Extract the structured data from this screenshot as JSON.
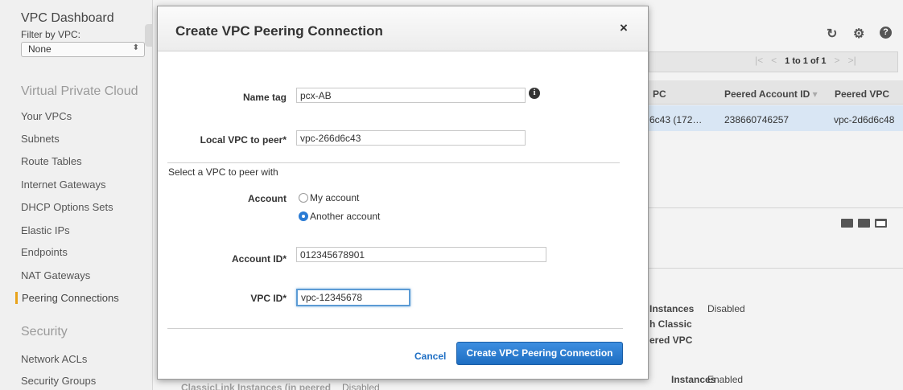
{
  "sidebar": {
    "title": "VPC Dashboard",
    "filter_label": "Filter by VPC:",
    "filter_value": "None",
    "sections": [
      {
        "label": "Virtual Private Cloud"
      },
      {
        "label": "Security"
      }
    ],
    "items": [
      {
        "label": "Your VPCs"
      },
      {
        "label": "Subnets"
      },
      {
        "label": "Route Tables"
      },
      {
        "label": "Internet Gateways"
      },
      {
        "label": "DHCP Options Sets"
      },
      {
        "label": "Elastic IPs"
      },
      {
        "label": "Endpoints"
      },
      {
        "label": "NAT Gateways"
      },
      {
        "label": "Peering Connections",
        "active": true
      },
      {
        "label": "Network ACLs"
      },
      {
        "label": "Security Groups"
      }
    ]
  },
  "toolbar": {
    "icons": [
      "refresh-icon",
      "gear-icon",
      "help-icon"
    ]
  },
  "pager": {
    "text": "1 to 1 of 1"
  },
  "table": {
    "columns": [
      "PC",
      "Peered Account ID",
      "Peered VPC"
    ],
    "rows": [
      [
        "6c43 (172…",
        "238660746257",
        "vpc-2d6d6c48"
      ]
    ]
  },
  "details": {
    "labels": [
      "Instances",
      "h Classic",
      "ered VPC",
      "Instances",
      "ClassicLink Instances (in peered"
    ],
    "values": [
      "Disabled",
      "Enabled",
      "Disabled"
    ]
  },
  "modal": {
    "title": "Create VPC Peering Connection",
    "close_label": "×",
    "name_tag": {
      "label": "Name tag",
      "value": "pcx-AB",
      "info_glyph": "i"
    },
    "local_vpc": {
      "label": "Local VPC to peer*",
      "value": "vpc-266d6c43"
    },
    "section_label": "Select a VPC to peer with",
    "account": {
      "label": "Account",
      "options": [
        {
          "label": "My account",
          "selected": false
        },
        {
          "label": "Another account",
          "selected": true
        }
      ]
    },
    "account_id": {
      "label": "Account ID*",
      "value": "012345678901"
    },
    "vpc_id": {
      "label": "VPC ID*",
      "value": "vpc-12345678"
    },
    "cancel_label": "Cancel",
    "submit_label": "Create VPC Peering Connection"
  },
  "colors": {
    "accent": "#2a7bd4",
    "active_marker": "#e8a31b",
    "selected_row": "#d9e6f4"
  }
}
